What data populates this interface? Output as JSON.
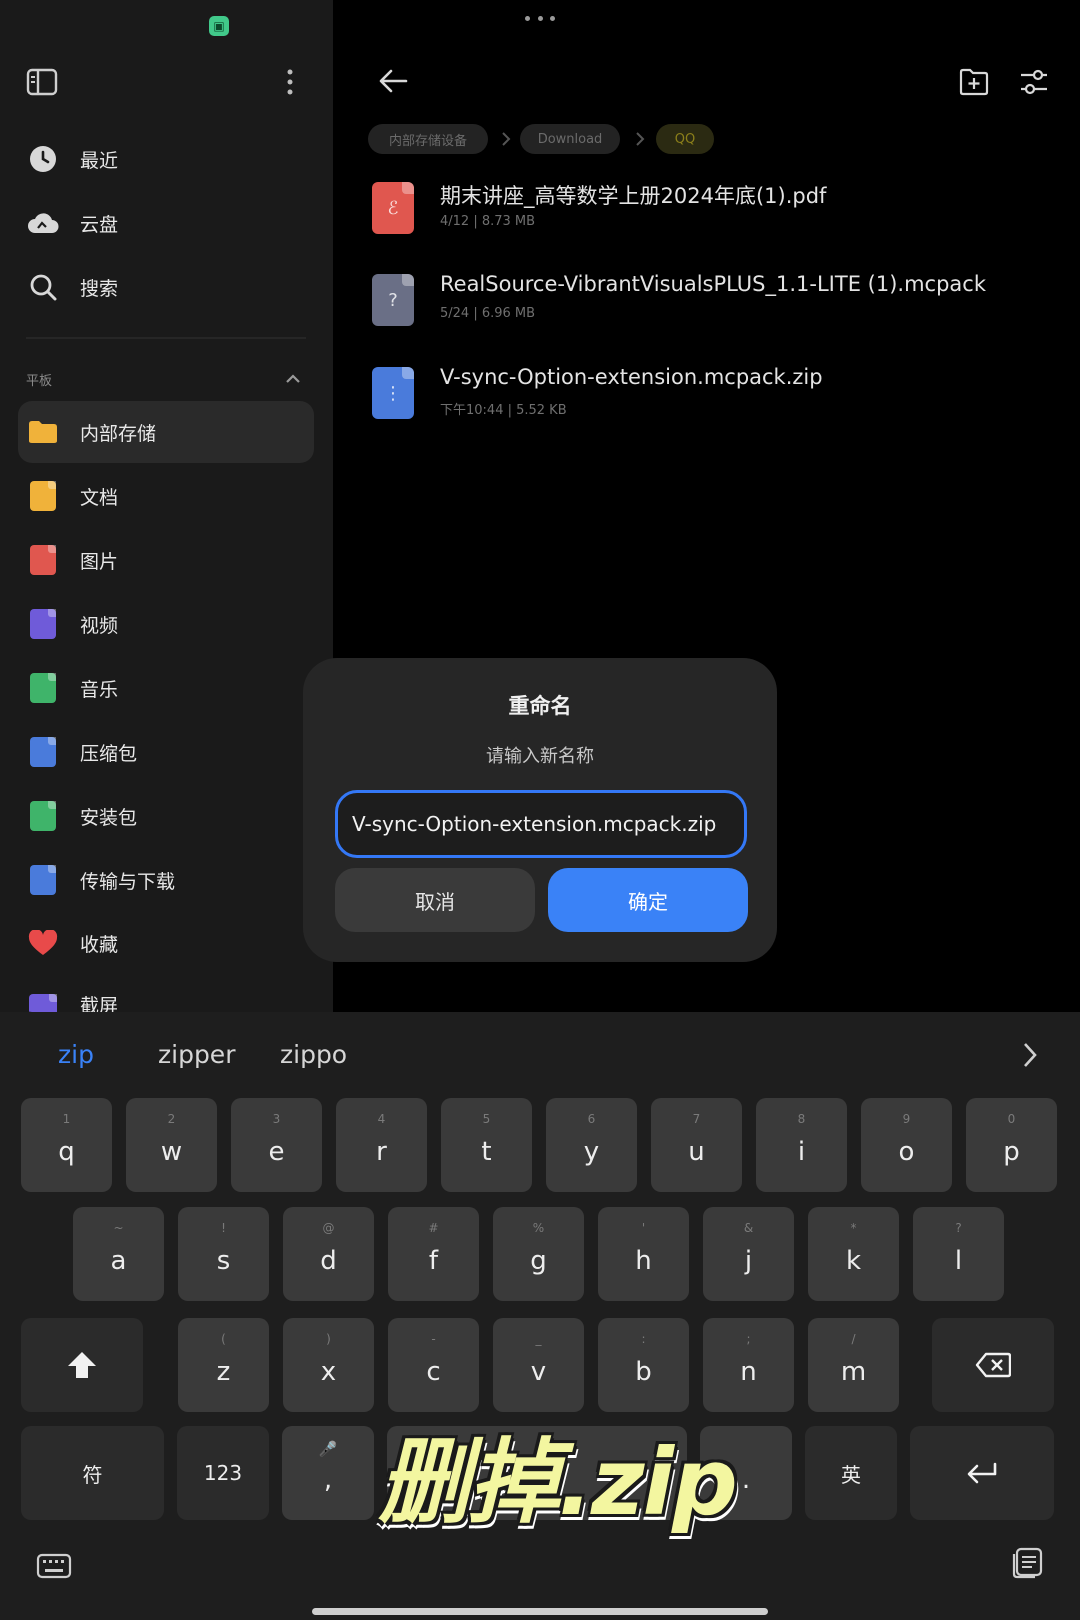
{
  "sidebar": {
    "items": [
      {
        "label": "最近",
        "icon": "clock-icon"
      },
      {
        "label": "云盘",
        "icon": "cloud-icon"
      },
      {
        "label": "搜索",
        "icon": "search-icon"
      }
    ],
    "section_label": "平板",
    "storage_items": [
      {
        "label": "内部存储",
        "icon": "folder-icon",
        "color": "#f0b23a"
      },
      {
        "label": "文档",
        "icon": "document-icon",
        "color": "#f0b23a"
      },
      {
        "label": "图片",
        "icon": "image-icon",
        "color": "#e0574f"
      },
      {
        "label": "视频",
        "icon": "video-icon",
        "color": "#6f5bd9"
      },
      {
        "label": "音乐",
        "icon": "music-icon",
        "color": "#3fb46a"
      },
      {
        "label": "压缩包",
        "icon": "archive-icon",
        "color": "#4a7bdb"
      },
      {
        "label": "安装包",
        "icon": "apk-icon",
        "color": "#3fb46a"
      },
      {
        "label": "传输与下载",
        "icon": "transfer-icon",
        "color": "#4a7bdb"
      },
      {
        "label": "收藏",
        "icon": "heart-icon",
        "color": "#e84a4a"
      },
      {
        "label": "截屏",
        "icon": "screenshot-icon",
        "color": "#6f5bd9"
      }
    ]
  },
  "breadcrumb": [
    "内部存储设备",
    "Download",
    "QQ"
  ],
  "files": [
    {
      "name": "期末讲座_高等数学上册2024年底(1).pdf",
      "meta": "4/12  |  8.73 MB",
      "icon": "pdf-file-icon",
      "color": "#e0574f",
      "glyph": "ℰ"
    },
    {
      "name": "RealSource-VibrantVisualsPLUS_1.1-LITE (1).mcpack",
      "meta": "5/24  |  6.96 MB",
      "icon": "unknown-file-icon",
      "color": "#6a6f86",
      "glyph": "?"
    },
    {
      "name": "V-sync-Option-extension.mcpack.zip",
      "meta": "下午10:44  |  5.52 KB",
      "icon": "zip-file-icon",
      "color": "#4a7bdb",
      "glyph": "⋮"
    }
  ],
  "dialog": {
    "title": "重命名",
    "subtitle": "请输入新名称",
    "input_value": "V-sync-Option-extension.mcpack.zip",
    "cancel_label": "取消",
    "ok_label": "确定"
  },
  "keyboard": {
    "suggestions": [
      "zip",
      "zipper",
      "zippo"
    ],
    "row1": [
      {
        "k": "q",
        "h": "1"
      },
      {
        "k": "w",
        "h": "2"
      },
      {
        "k": "e",
        "h": "3"
      },
      {
        "k": "r",
        "h": "4"
      },
      {
        "k": "t",
        "h": "5"
      },
      {
        "k": "y",
        "h": "6"
      },
      {
        "k": "u",
        "h": "7"
      },
      {
        "k": "i",
        "h": "8"
      },
      {
        "k": "o",
        "h": "9"
      },
      {
        "k": "p",
        "h": "0"
      }
    ],
    "row2": [
      {
        "k": "a",
        "h": "~"
      },
      {
        "k": "s",
        "h": "!"
      },
      {
        "k": "d",
        "h": "@"
      },
      {
        "k": "f",
        "h": "#"
      },
      {
        "k": "g",
        "h": "%"
      },
      {
        "k": "h",
        "h": "'"
      },
      {
        "k": "j",
        "h": "&"
      },
      {
        "k": "k",
        "h": "*"
      },
      {
        "k": "l",
        "h": "?"
      }
    ],
    "row3": [
      {
        "k": "z",
        "h": "("
      },
      {
        "k": "x",
        "h": ")"
      },
      {
        "k": "c",
        "h": "-"
      },
      {
        "k": "v",
        "h": "_"
      },
      {
        "k": "b",
        "h": ":"
      },
      {
        "k": "n",
        "h": ";"
      },
      {
        "k": "m",
        "h": "/"
      }
    ],
    "symbols_label": "符",
    "numbers_label": "123",
    "comma_label": ",",
    "period_label": ".",
    "lang_label": "英"
  },
  "overlay_caption": "删掉.zip"
}
